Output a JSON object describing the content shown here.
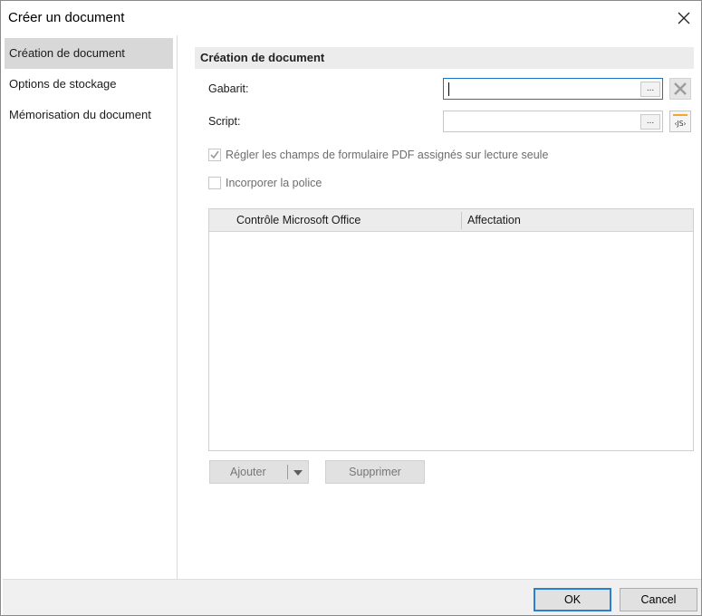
{
  "window": {
    "title": "Créer un document",
    "close_icon": "close-icon"
  },
  "sidebar": {
    "items": [
      {
        "label": "Création de document",
        "active": true
      },
      {
        "label": "Options de stockage",
        "active": false
      },
      {
        "label": "Mémorisation du document",
        "active": false
      }
    ]
  },
  "main": {
    "section_title": "Création de document",
    "gabarit": {
      "label": "Gabarit:",
      "value": "",
      "browse_label": "..."
    },
    "script": {
      "label": "Script:",
      "value": "",
      "browse_label": "...",
      "js_label": "‹JS›"
    },
    "checkboxes": [
      {
        "label": "Régler les champs de formulaire PDF assignés sur lecture seule",
        "checked": true,
        "enabled": false
      },
      {
        "label": "Incorporer la police",
        "checked": false,
        "enabled": false
      }
    ],
    "grid": {
      "columns": [
        "Contrôle Microsoft Office",
        "Affectation"
      ],
      "rows": []
    },
    "buttons": {
      "add_label": "Ajouter",
      "remove_label": "Supprimer"
    }
  },
  "footer": {
    "ok_label": "OK",
    "cancel_label": "Cancel"
  },
  "colors": {
    "accent": "#2a7fd4",
    "focus_border": "#1a73c9",
    "active_nav": "#d8d8d8"
  }
}
